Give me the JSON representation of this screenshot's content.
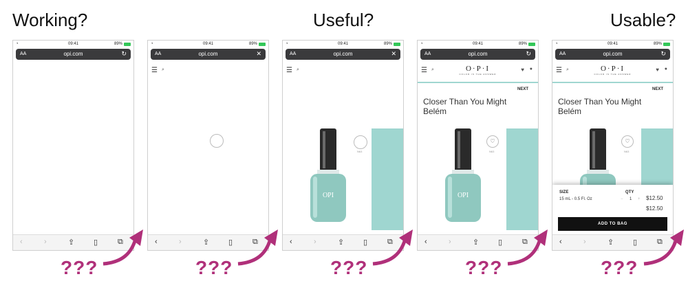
{
  "headings": [
    "Working?",
    "Useful?",
    "Usable?"
  ],
  "question_marks": "???",
  "phones": [
    {
      "time": "09:41",
      "battery": "89%",
      "aa": "AA",
      "url": "opi.com",
      "urlbar_action": "↻"
    },
    {
      "time": "09:41",
      "battery": "89%",
      "aa": "AA",
      "url": "opi.com",
      "urlbar_action": "✕"
    },
    {
      "time": "09:41",
      "battery": "89%",
      "aa": "AA",
      "url": "opi.com",
      "urlbar_action": "✕"
    },
    {
      "time": "09:41",
      "battery": "89%",
      "aa": "AA",
      "url": "opi.com",
      "urlbar_action": "↻"
    },
    {
      "time": "09:41",
      "battery": "89%",
      "aa": "AA",
      "url": "opi.com",
      "urlbar_action": "↻"
    }
  ],
  "site": {
    "logo": "O·P·I",
    "tagline": "COLOR IS THE ANSWER",
    "next": "NEXT",
    "product_title": "Closer Than You Might Belém",
    "sku": "N63"
  },
  "cart_sheet": {
    "size_label": "SIZE",
    "size_value": "15 mL - 0.5 Fl. Oz",
    "qty_label": "QTY",
    "qty_value": "1",
    "price": "$12.50",
    "total": "$12.50",
    "add_to_bag": "ADD TO BAG"
  },
  "colors": {
    "accent": "#b0307a",
    "teal": "#9fd6d0"
  }
}
